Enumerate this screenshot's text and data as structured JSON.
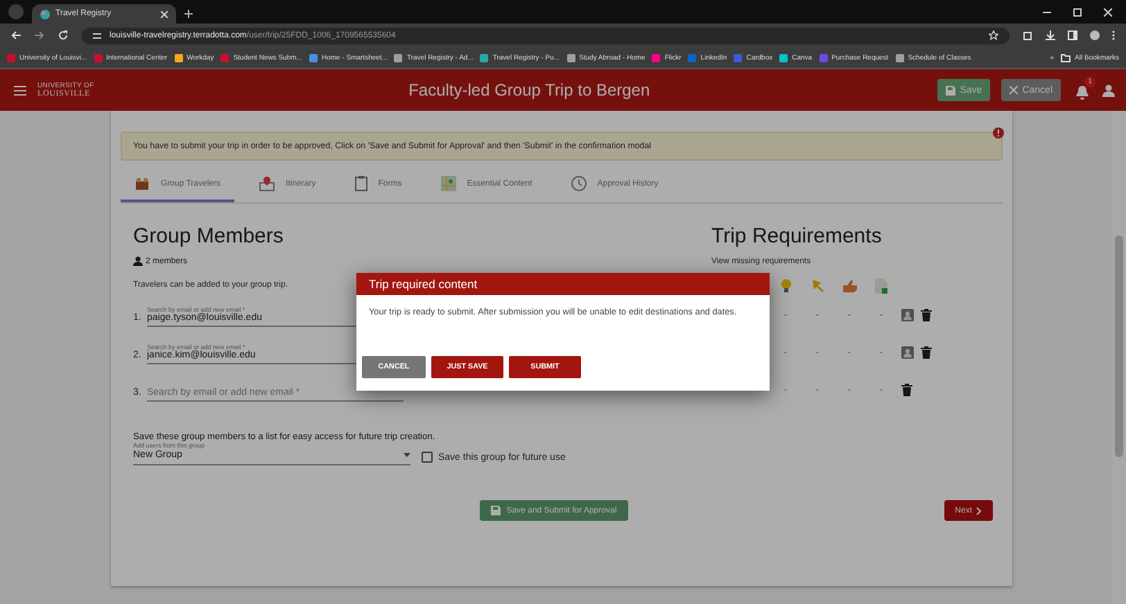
{
  "browser": {
    "tab_title": "Travel Registry",
    "url_host": "louisville-travelregistry.terradotta.com",
    "url_path": "/user/trip/25FDD_1006_1709565535604",
    "bookmarks": [
      {
        "label": "University of Louisvi...",
        "color": "#c8102e"
      },
      {
        "label": "International Center",
        "color": "#c8102e"
      },
      {
        "label": "Workday",
        "color": "#f5a623"
      },
      {
        "label": "Student News Subm...",
        "color": "#c8102e"
      },
      {
        "label": "Home - Smartsheet...",
        "color": "#4a90e2"
      },
      {
        "label": "Travel Registry - Ad...",
        "color": "#9e9e9e"
      },
      {
        "label": "Travel Registry - Pu...",
        "color": "#2aa7a0"
      },
      {
        "label": "Study Abroad - Home",
        "color": "#9e9e9e"
      },
      {
        "label": "Flickr",
        "color": "#ff0084"
      },
      {
        "label": "LinkedIn",
        "color": "#0a66c2"
      },
      {
        "label": "Cardbox",
        "color": "#3b5bdb"
      },
      {
        "label": "Canva",
        "color": "#00c4cc"
      },
      {
        "label": "Purchase Request",
        "color": "#7048e8"
      },
      {
        "label": "Schedule of Classes",
        "color": "#9e9e9e"
      }
    ],
    "more": "»",
    "all_bookmarks": "All Bookmarks"
  },
  "header": {
    "logo_small": "UNIVERSITY OF",
    "logo": "LOUISVILLE",
    "title": "Faculty-led Group Trip to Bergen",
    "save": "Save",
    "cancel": "Cancel",
    "notifications": "1"
  },
  "alert": "You have to submit your trip in order to be approved, Click on 'Save and Submit for Approval' and then 'Submit' in the confirmation modal",
  "tabs": [
    {
      "label": "Group Travelers",
      "kind": "group",
      "selected": true
    },
    {
      "label": "Itinerary",
      "kind": "pin",
      "selected": false
    },
    {
      "label": "Forms",
      "kind": "clipboard",
      "selected": false
    },
    {
      "label": "Essential Content",
      "kind": "map",
      "selected": false
    },
    {
      "label": "Approval History",
      "kind": "history",
      "selected": false
    }
  ],
  "group": {
    "heading": "Group Members",
    "member_count": "2 members",
    "intro": "Travelers can be added to your group trip.",
    "travelers": [
      {
        "number": "1.",
        "label": "Search by email or add new email *",
        "value": "paige.tyson@louisville.edu"
      },
      {
        "number": "2.",
        "label": "Search by email or add new email *",
        "value": "janice.kim@louisville.edu"
      },
      {
        "number": "3.",
        "placeholder": "Search by email or add new email *"
      }
    ],
    "save_text": "Save these group members to a list for easy access for future trip creation.",
    "dropdown_label": "Add users from this group",
    "dropdown_value": "New Group",
    "save_checkbox": {
      "label": "Save this group for future use",
      "checked": false
    }
  },
  "requirements": {
    "heading": "Trip Requirements",
    "link": "View missing requirements",
    "columns": [
      {
        "kind": "bulb"
      },
      {
        "kind": "pin"
      },
      {
        "kind": "hand"
      },
      {
        "kind": "doc"
      }
    ],
    "rows": [
      {
        "cells": [
          "-",
          "-",
          "-",
          "-"
        ],
        "has_profile": true
      },
      {
        "cells": [
          "-",
          "-",
          "-",
          "-"
        ],
        "has_profile": true
      },
      {
        "cells": [
          "-",
          "-",
          "-",
          "-"
        ],
        "has_profile": false
      }
    ]
  },
  "footer": {
    "submit": "Save and Submit for Approval",
    "next": "Next"
  },
  "modal": {
    "title": "Trip required content",
    "body": "Your trip is ready to submit. After submission you will be unable to edit destinations and dates.",
    "buttons": [
      {
        "label": "CANCEL",
        "kind": "secondary"
      },
      {
        "label": "JUST SAVE",
        "kind": "primary"
      },
      {
        "label": "SUBMIT",
        "kind": "primary"
      }
    ]
  }
}
